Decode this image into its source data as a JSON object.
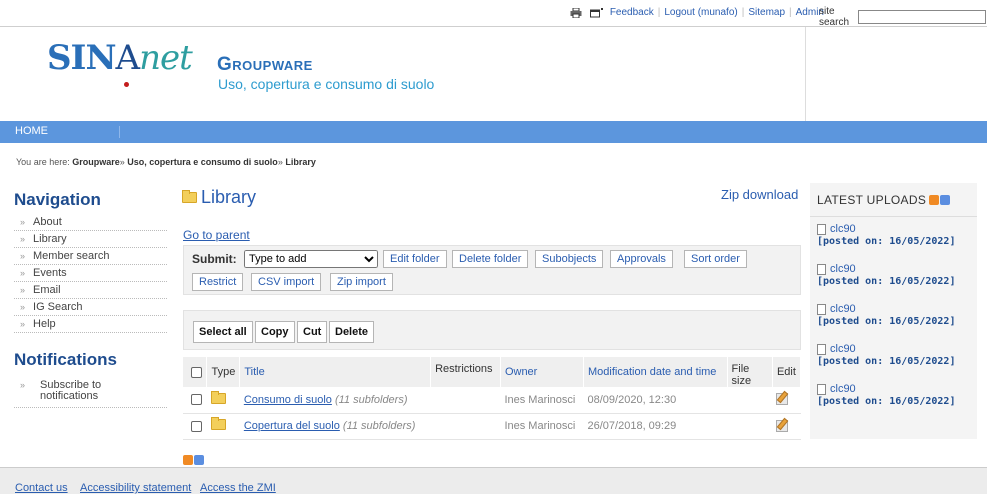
{
  "topbar": {
    "print_icon": "printer-icon",
    "fullscreen_icon": "screen-icon",
    "links": [
      "Feedback",
      "Logout (munafo)",
      "Sitemap",
      "Admin"
    ],
    "search_label": "site search",
    "search_value": ""
  },
  "header": {
    "logo_part1": "SIN",
    "logo_part2": "A",
    "logo_part3": "net",
    "title": "Groupware",
    "subtitle": "Uso, copertura e consumo di suolo"
  },
  "menubar": {
    "home": "HOME"
  },
  "breadcrumb": {
    "prefix": "You are here:",
    "items": [
      "Groupware",
      "Uso, copertura e consumo di suolo",
      "Library"
    ],
    "sep": "»"
  },
  "navigation": {
    "heading": "Navigation",
    "items": [
      "About",
      "Library",
      "Member search",
      "Events",
      "Email",
      "IG Search",
      "Help"
    ]
  },
  "notifications": {
    "heading": "Notifications",
    "items": [
      "Subscribe to notifications"
    ]
  },
  "main": {
    "title": "Library",
    "zip_download": "Zip download",
    "go_to_parent": "Go to parent",
    "submit_label": "Submit:",
    "submit_select": "Type to add",
    "folder_buttons": [
      "Edit folder",
      "Delete folder",
      "Subobjects",
      "Approvals",
      "Sort order",
      "Restrict",
      "CSV import",
      "Zip import"
    ],
    "action_buttons": [
      "Select all",
      "Copy",
      "Cut",
      "Delete"
    ],
    "table": {
      "headers": [
        "Type",
        "Title",
        "Restrictions",
        "Owner",
        "Modification date and time",
        "File size",
        "Edit"
      ],
      "rows": [
        {
          "title": "Consumo di suolo",
          "note": "(11 subfolders)",
          "owner": "Ines Marinosci",
          "modified": "08/09/2020, 12:30"
        },
        {
          "title": "Copertura del suolo",
          "note": "(11 subfolders)",
          "owner": "Ines Marinosci",
          "modified": "26/07/2018, 09:29"
        }
      ]
    }
  },
  "latest_uploads": {
    "heading": "LATEST UPLOADS",
    "items": [
      {
        "name": "clc90",
        "posted": "[posted on: 16/05/2022]"
      },
      {
        "name": "clc90",
        "posted": "[posted on: 16/05/2022]"
      },
      {
        "name": "clc90",
        "posted": "[posted on: 16/05/2022]"
      },
      {
        "name": "clc90",
        "posted": "[posted on: 16/05/2022]"
      },
      {
        "name": "clc90",
        "posted": "[posted on: 16/05/2022]"
      }
    ]
  },
  "footer": {
    "links": [
      "Contact us",
      "Accessibility statement",
      "Access the ZMI"
    ]
  },
  "colors": {
    "menubar": "#5c96dd",
    "link": "#2a5db0",
    "heading": "#1e4c8e",
    "rss_orange": "#f08a24"
  }
}
